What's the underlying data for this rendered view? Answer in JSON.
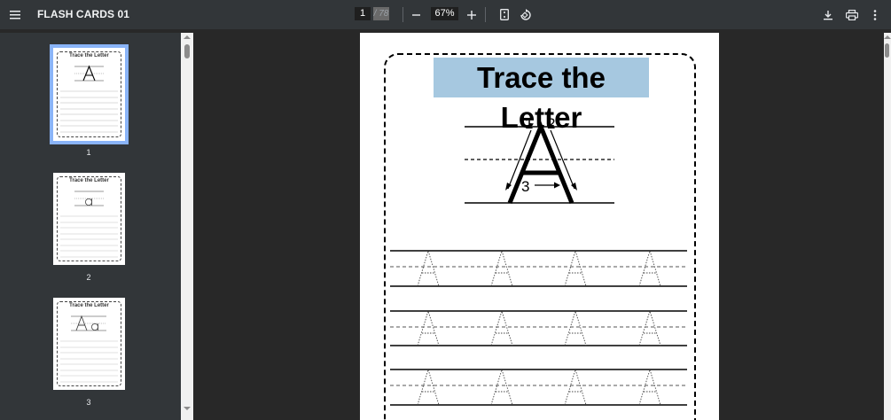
{
  "toolbar": {
    "title": "FLASH CARDS 01",
    "page_current": "1",
    "page_total": "/ 78",
    "zoom": "67%",
    "icons": [
      "menu-icon",
      "zoom-out-icon",
      "zoom-in-icon",
      "fit-page-icon",
      "rotate-icon",
      "download-icon",
      "print-icon",
      "more-vert-icon"
    ]
  },
  "sidebar": {
    "thumbnails": [
      {
        "title": "Trace the Letter",
        "number": "1",
        "selected": true
      },
      {
        "title": "Trace the Letter",
        "number": "2",
        "selected": false
      },
      {
        "title": "Trace the Letter",
        "number": "3",
        "selected": false
      }
    ]
  },
  "page": {
    "title": "Trace the Letter",
    "stroke_numbers": [
      "1",
      "2",
      "3"
    ],
    "letter": "A"
  }
}
